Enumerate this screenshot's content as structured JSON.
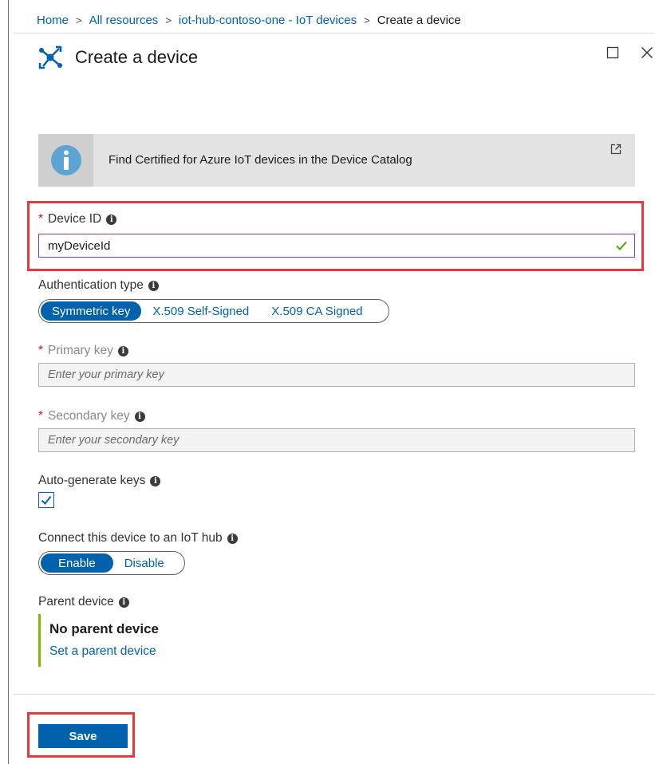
{
  "breadcrumb": [
    {
      "label": "Home",
      "link": true
    },
    {
      "label": "All resources",
      "link": true
    },
    {
      "label": "iot-hub-contoso-one - IoT devices",
      "link": true
    },
    {
      "label": "Create a device",
      "link": false
    }
  ],
  "breadcrumb_separator": ">",
  "header": {
    "title": "Create a device",
    "icon": "iot-device-icon"
  },
  "window_controls": {
    "maximize_icon": "maximize-icon",
    "close_icon": "close-icon"
  },
  "info_banner": {
    "text": "Find Certified for Azure IoT devices in the Device Catalog",
    "icon": "info-icon",
    "external_icon": "external-link-icon"
  },
  "device_id": {
    "required_marker": "*",
    "label": "Device ID",
    "value": "myDeviceId",
    "valid": true
  },
  "authentication": {
    "label": "Authentication type",
    "options": [
      "Symmetric key",
      "X.509 Self-Signed",
      "X.509 CA Signed"
    ],
    "selected": "Symmetric key"
  },
  "primary_key": {
    "required_marker": "*",
    "label": "Primary key",
    "placeholder": "Enter your primary key"
  },
  "secondary_key": {
    "required_marker": "*",
    "label": "Secondary key",
    "placeholder": "Enter your secondary key"
  },
  "auto_generate": {
    "label": "Auto-generate keys",
    "checked": true
  },
  "connect_hub": {
    "label": "Connect this device to an IoT hub",
    "options": [
      "Enable",
      "Disable"
    ],
    "selected": "Enable"
  },
  "parent_device": {
    "label": "Parent device",
    "value": "No parent device",
    "link": "Set a parent device"
  },
  "footer": {
    "save_label": "Save"
  },
  "colors": {
    "accent": "#0062ad",
    "highlight": "#e5393d",
    "required": "#e00b1c",
    "parent_bar": "#7fba00",
    "valid_check": "#57a300"
  }
}
